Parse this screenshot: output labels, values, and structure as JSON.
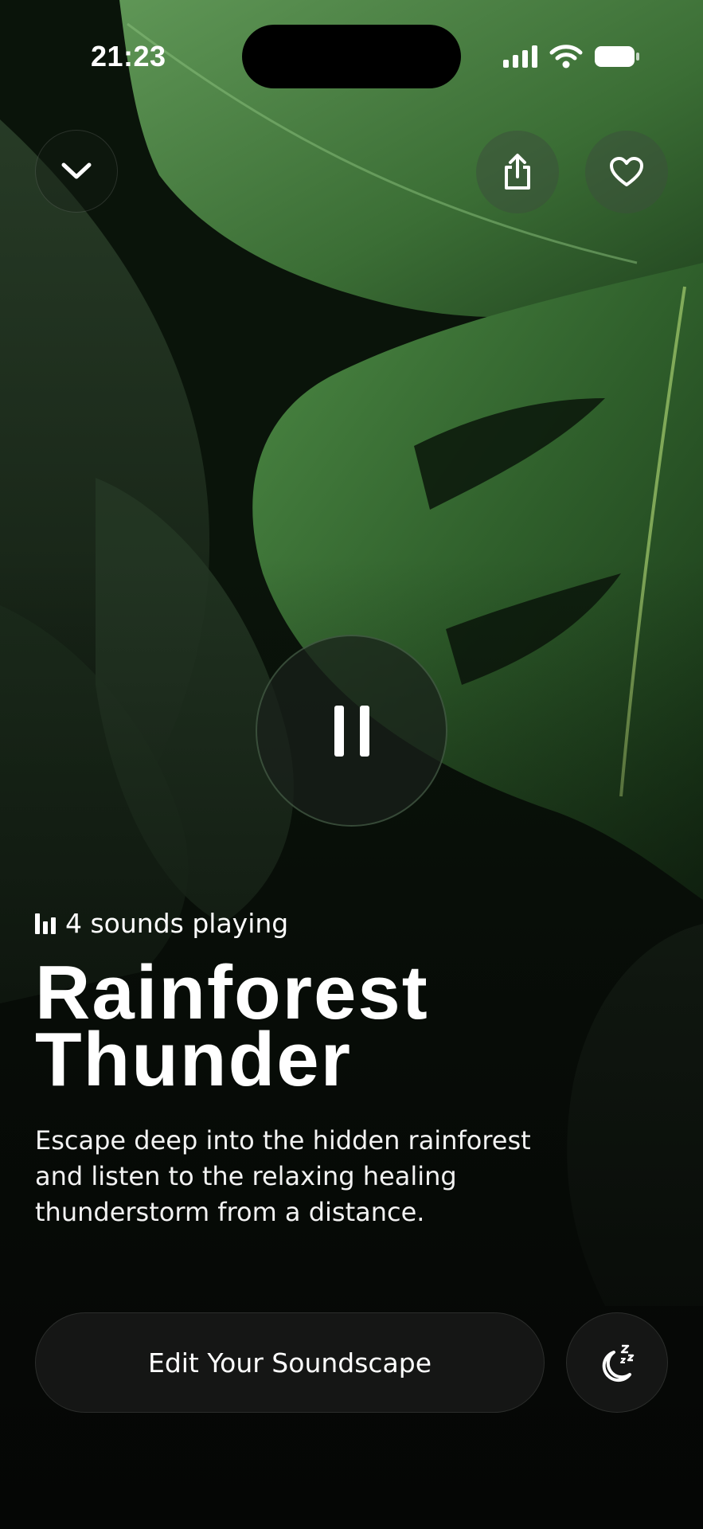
{
  "status_bar": {
    "time": "21:23"
  },
  "top_controls": {
    "collapse_icon": "chevron-down-icon",
    "share_icon": "share-icon",
    "favorite_icon": "heart-icon"
  },
  "player": {
    "pause_icon": "pause-icon",
    "sounds_playing": "4 sounds playing",
    "title_line1": "Rainforest",
    "title_line2": "Thunder",
    "description_line1": "Escape deep into the hidden rainforest",
    "description_line2": "and listen to the relaxing healing",
    "description_line3": "thunderstorm from a distance."
  },
  "actions": {
    "edit_label": "Edit Your Soundscape",
    "sleep_icon": "moon-zzz-icon"
  },
  "colors": {
    "background": "#050605",
    "leaf_green": "#3f7a3a",
    "button_dark": "#151615",
    "text": "#ffffff"
  }
}
